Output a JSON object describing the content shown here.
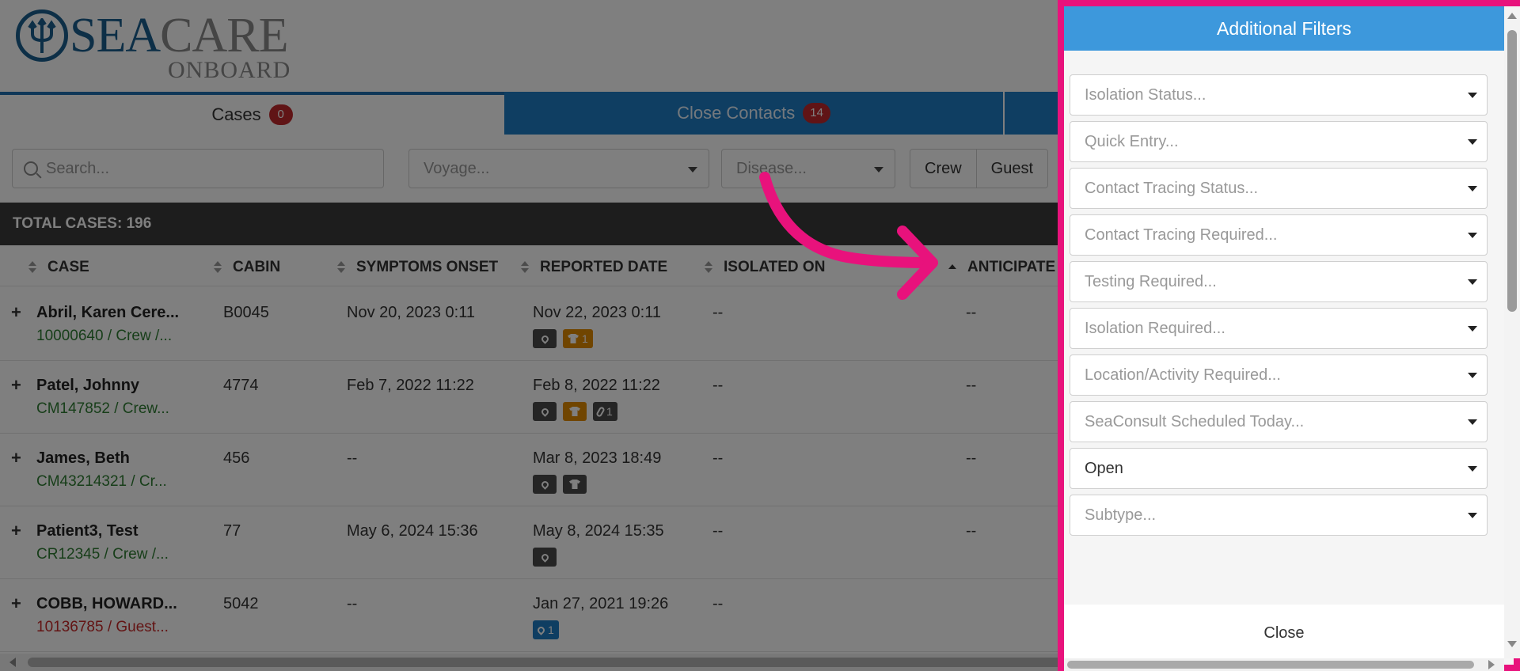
{
  "logo": {
    "sea": "SEA",
    "care": "CARE",
    "onboard": "ONBOARD"
  },
  "tabs": [
    {
      "label": "Cases",
      "count": "0"
    },
    {
      "label": "Close Contacts",
      "count": "14"
    }
  ],
  "filters": {
    "search_placeholder": "Search...",
    "voyage_placeholder": "Voyage...",
    "disease_placeholder": "Disease...",
    "segment": [
      "Crew",
      "Guest"
    ]
  },
  "total_label": "TOTAL CASES: 196",
  "columns": [
    "CASE",
    "CABIN",
    "SYMPTOMS ONSET",
    "REPORTED DATE",
    "ISOLATED ON",
    "ANTICIPATE"
  ],
  "rows": [
    {
      "name": "Abril, Karen Cere...",
      "sub": "10000640 / Crew /...",
      "cabin": "B0045",
      "onset": "Nov 20, 2023 0:11",
      "reported": "Nov 22, 2023 0:11",
      "isolated": "--",
      "anticipated": "--",
      "shirt_count": "1"
    },
    {
      "name": "Patel, Johnny",
      "sub": "CM147852 / Crew...",
      "cabin": "4774",
      "onset": "Feb 7, 2022 11:22",
      "reported": "Feb 8, 2022 11:22",
      "isolated": "--",
      "anticipated": "--",
      "clip_count": "1"
    },
    {
      "name": "James, Beth",
      "sub": "CM43214321 / Cr...",
      "cabin": "456",
      "onset": "--",
      "reported": "Mar 8, 2023 18:49",
      "isolated": "--",
      "anticipated": "--"
    },
    {
      "name": "Patient3, Test",
      "sub": "CR12345 / Crew /...",
      "cabin": "77",
      "onset": "May 6, 2024 15:36",
      "reported": "May 8, 2024 15:35",
      "isolated": "--",
      "anticipated": "--"
    },
    {
      "name": "COBB, HOWARD...",
      "sub": "10136785 / Guest...",
      "cabin": "5042",
      "onset": "--",
      "reported": "Jan 27, 2021 19:26",
      "isolated": "--",
      "anticipated": "",
      "pin_count": "1"
    }
  ],
  "panel": {
    "title": "Additional Filters",
    "fields": [
      "Isolation Status...",
      "Quick Entry...",
      "Contact Tracing Status...",
      "Contact Tracing Required...",
      "Testing Required...",
      "Isolation Required...",
      "Location/Activity Required...",
      "SeaConsult Scheduled Today...",
      "Open",
      "Subtype..."
    ],
    "close_label": "Close"
  },
  "colors": {
    "highlight": "#e8127c",
    "header_blue": "#3d98dc",
    "tab_blue": "#1e7dc4",
    "badge_red": "#c0282d"
  }
}
